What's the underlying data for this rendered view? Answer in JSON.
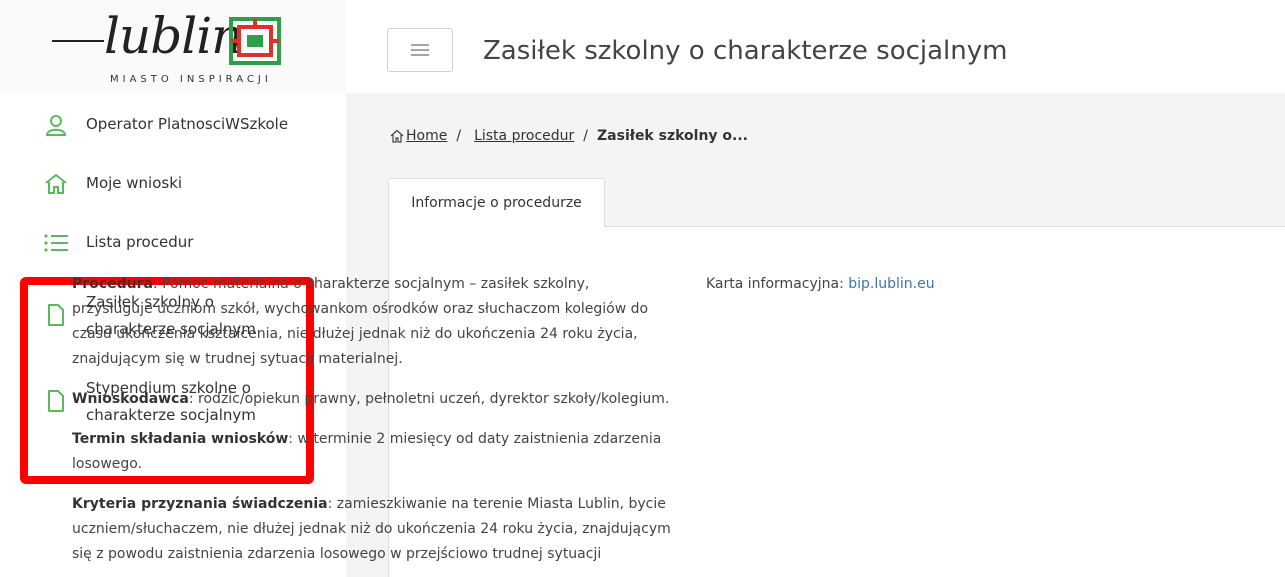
{
  "logo": {
    "text": "lublin",
    "subtitle": "MIASTO INSPIRACJI"
  },
  "sidebar": {
    "items": [
      {
        "label": "Operator PlatnosciWSzkole",
        "icon": "user-icon"
      },
      {
        "label": "Moje wnioski",
        "icon": "home-icon"
      },
      {
        "label": "Lista procedur",
        "icon": "list-icon"
      },
      {
        "label": "Zasiłek szkolny o charakterze socjalnym",
        "icon": "document-icon"
      },
      {
        "label": "Stypendium szkolne o charakterze socjalnym",
        "icon": "document-icon"
      }
    ]
  },
  "header": {
    "title": "Zasiłek szkolny o charakterze socjalnym"
  },
  "breadcrumb": {
    "home": "Home",
    "separator": "/",
    "list": "Lista procedur",
    "current": "Zasiłek szkolny o..."
  },
  "tabs": [
    {
      "label": "Informacje o procedurze"
    }
  ],
  "content": {
    "procedura_label": "Procedura",
    "procedura_text": ": Pomoc materialna o charakterze socjalnym – zasiłek szkolny, przysługuje uczniom szkół, wychowankom ośrodków oraz słuchaczom kolegiów do czasu ukończenia kształcenia, nie dłużej jednak niż do ukończenia 24 roku życia, znajdującym się w trudnej sytuacji materialnej.",
    "wnioskodawca_label": "Wnioskodawca",
    "wnioskodawca_text": ": rodzic/opiekun prawny, pełnoletni uczeń, dyrektor szkoły/kolegium.",
    "termin_label": "Termin składania wniosków",
    "termin_text": ": w terminie 2 miesięcy od daty zaistnienia zdarzenia losowego.",
    "kryteria_label": "Kryteria przyznania świadczenia",
    "kryteria_text": ": zamieszkiwanie na terenie Miasta Lublin, bycie uczniem/słuchaczem, nie dłużej jednak niż do ukończenia 24 roku życia, znajdującym się z powodu zaistnienia zdarzenia losowego w przejściowo trudnej sytuacji",
    "karta_label": "Karta informacyjna: ",
    "karta_link": "bip.lublin.eu"
  },
  "colors": {
    "accent_green": "#5cb85c",
    "highlight_red": "#ff0000",
    "link_blue": "#3a74b8"
  }
}
